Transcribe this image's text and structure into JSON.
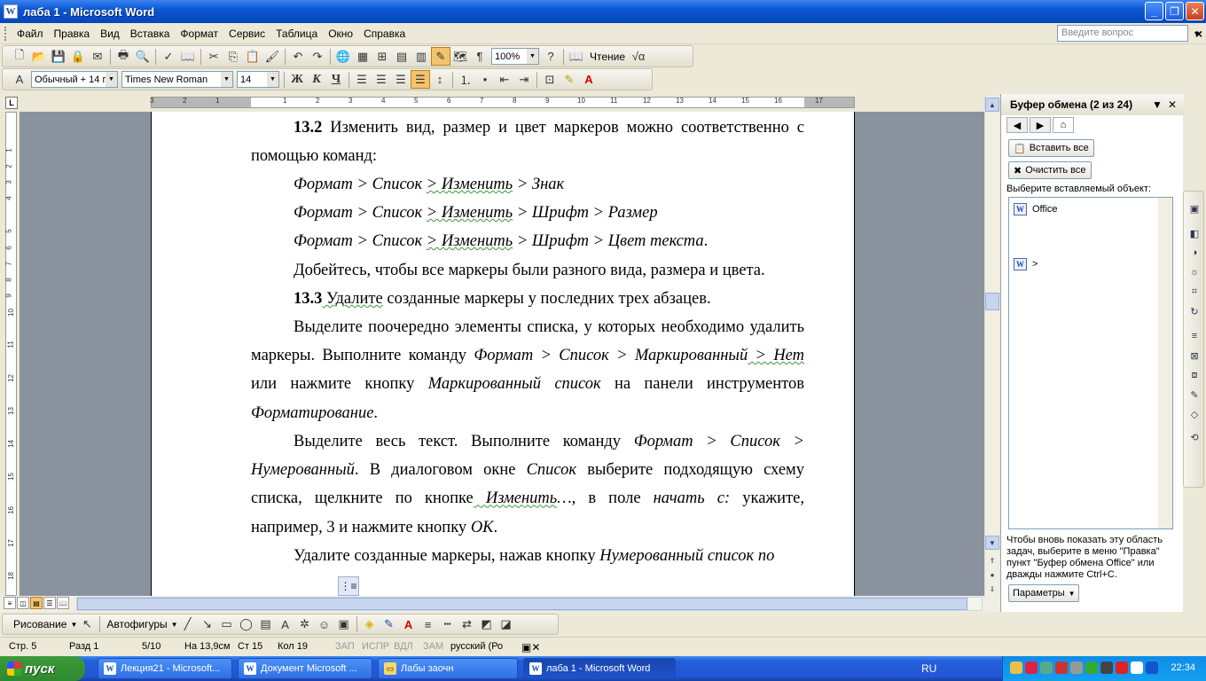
{
  "window": {
    "title": "лаба 1 - Microsoft Word",
    "app_icon": "word-icon",
    "controls": [
      "minimize-icon",
      "restore-icon",
      "close-icon"
    ]
  },
  "menu": {
    "items": [
      "Файл",
      "Правка",
      "Вид",
      "Вставка",
      "Формат",
      "Сервис",
      "Таблица",
      "Окно",
      "Справка"
    ],
    "help_placeholder": "Введите вопрос"
  },
  "toolbar_standard": {
    "zoom": "100%",
    "reading_label": "Чтение"
  },
  "toolbar_format": {
    "style": "Обычный + 14 г",
    "font": "Times New Roman",
    "size": "14",
    "bold_label": "Ж",
    "italic_label": "К",
    "underline_label": "Ч"
  },
  "ruler": {
    "h_numbers": [
      "3",
      "2",
      "1",
      "1",
      "2",
      "3",
      "4",
      "5",
      "6",
      "7",
      "8",
      "9",
      "10",
      "11",
      "12",
      "13",
      "14",
      "15",
      "16",
      "17"
    ],
    "v_numbers": [
      "1",
      "2",
      "3",
      "4",
      "5",
      "6",
      "7",
      "8",
      "9",
      "10",
      "11",
      "12",
      "13",
      "14",
      "15",
      "16",
      "17",
      "18"
    ]
  },
  "document": {
    "p1": {
      "num": "13.2",
      "text": " Изменить вид, размер и цвет маркеров можно соответственно с помощью команд:"
    },
    "p2": {
      "a": "Формат",
      "b": "  > Список ",
      "c": "> Изменить",
      "d": " > Знак"
    },
    "p3": {
      "a": "Формат",
      "b": "  > Список ",
      "c": "> Изменить",
      "d": " > Шрифт > Размер"
    },
    "p4": {
      "a": "Формат",
      "b": "  > Список ",
      "c": "> Изменить",
      "d": " > Шрифт > Цвет текста",
      "e": "."
    },
    "p5": "Добейтесь, чтобы все маркеры были разного вида, размера и цвета.",
    "p6": {
      "num": "13.3",
      "sq": " Удалите",
      "text": " созданные маркеры у последних трех абзацев."
    },
    "p7": {
      "a": "Выделите поочередно элементы списка, у которых необходимо удалить маркеры. Выполните команду ",
      "b": "Формат > Список > Маркированный",
      "c": " > Нет",
      "d": " или нажмите кнопку ",
      "e": "Маркированный список",
      "f": " на панели инструментов ",
      "g": "Форматирование",
      "h": "."
    },
    "p8": {
      "a": "Выделите весь текст. Выполните команду ",
      "b": "Формат > Список > Нумерованный",
      "c": ". В диалоговом окне ",
      "d": "Список",
      "e": " выберите подходящую схему списка, щелкните по кнопке",
      "f": " Изменить",
      "g": "…",
      "h": ", в поле ",
      "i": "начать с:",
      "j": " укажите, например, 3 и нажмите кнопку ",
      "k": "ОК",
      "l": "."
    },
    "p9": {
      "a": "Удалите созданные маркеры, нажав кнопку ",
      "b": "Нумерованный список по"
    }
  },
  "taskpane": {
    "title": "Буфер обмена (2 из 24)",
    "paste_all": "Вставить все",
    "clear_all": "Очистить все",
    "choose_label": "Выберите вставляемый объект:",
    "items": [
      "Office",
      ">"
    ],
    "hint": "Чтобы вновь показать эту область задач, выберите в меню \"Правка\" пункт \"Буфер обмена Office\" или дважды нажмите Ctrl+C.",
    "params": "Параметры"
  },
  "drawing_toolbar": {
    "drawing": "Рисование",
    "autoshapes": "Автофигуры"
  },
  "statusbar": {
    "page": "Стр.  5",
    "section": "Разд  1",
    "pages": "5/10",
    "at": "На  13,9см",
    "line": "Ст  15",
    "col": "Кол  19",
    "rec": "ЗАП",
    "trk": "ИСПР",
    "ext": "ВДЛ",
    "ovr": "ЗАМ",
    "lang": "русский (Ро"
  },
  "taskbar": {
    "start": "пуск",
    "tasks": [
      "Лекция21 - Microsoft...",
      "Документ Microsoft ...",
      "Лабы заочн",
      "лаба 1 - Microsoft Word"
    ],
    "lang": "RU",
    "clock": "22:34"
  }
}
